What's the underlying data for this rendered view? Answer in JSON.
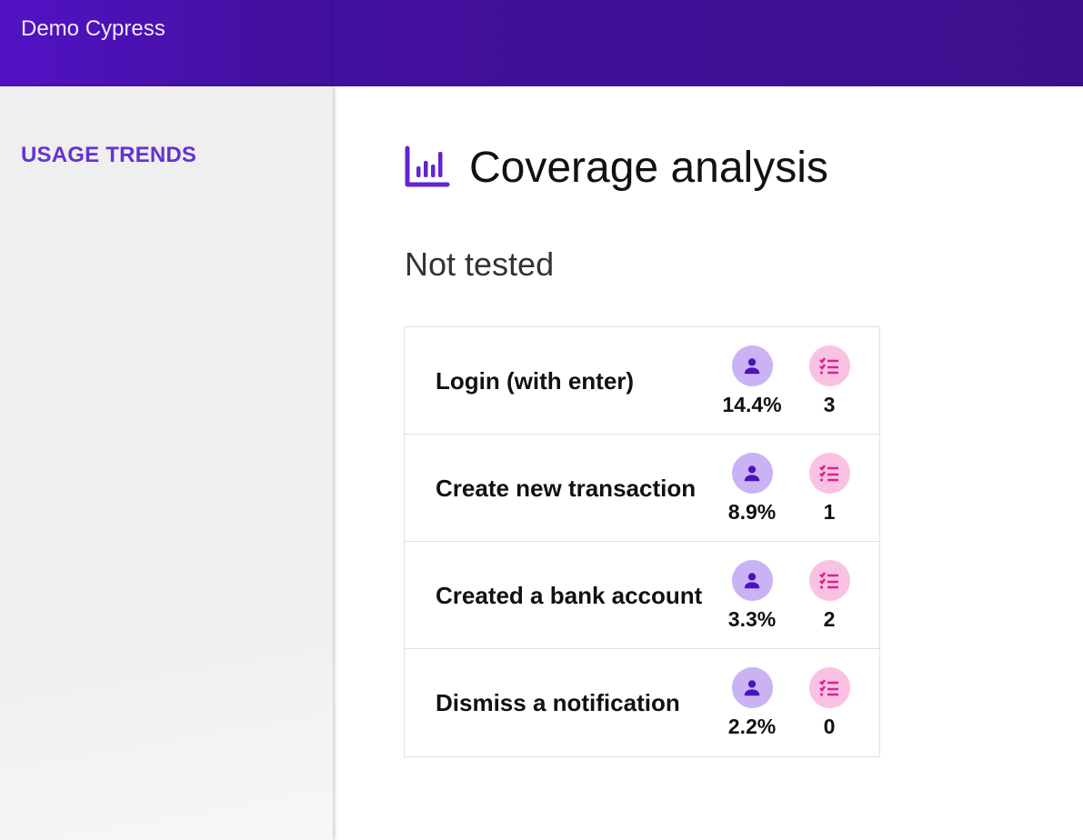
{
  "header": {
    "title": "Demo Cypress"
  },
  "sidebar": {
    "items": [
      {
        "label": "USAGE TRENDS"
      }
    ]
  },
  "main": {
    "title": "Coverage analysis",
    "title_icon": "bar-chart-icon",
    "section": "Not tested",
    "rows": [
      {
        "name": "Login (with enter)",
        "usage": "14.4%",
        "tests": "3"
      },
      {
        "name": "Create new transaction",
        "usage": "8.9%",
        "tests": "1"
      },
      {
        "name": "Created a bank account",
        "usage": "3.3%",
        "tests": "2"
      },
      {
        "name": "Dismiss a notification",
        "usage": "2.2%",
        "tests": "0"
      }
    ]
  },
  "colors": {
    "header": "#3d0f8c",
    "accent": "#6431d6",
    "user_icon": "#4a14b8",
    "list_icon": "#e0208f"
  }
}
